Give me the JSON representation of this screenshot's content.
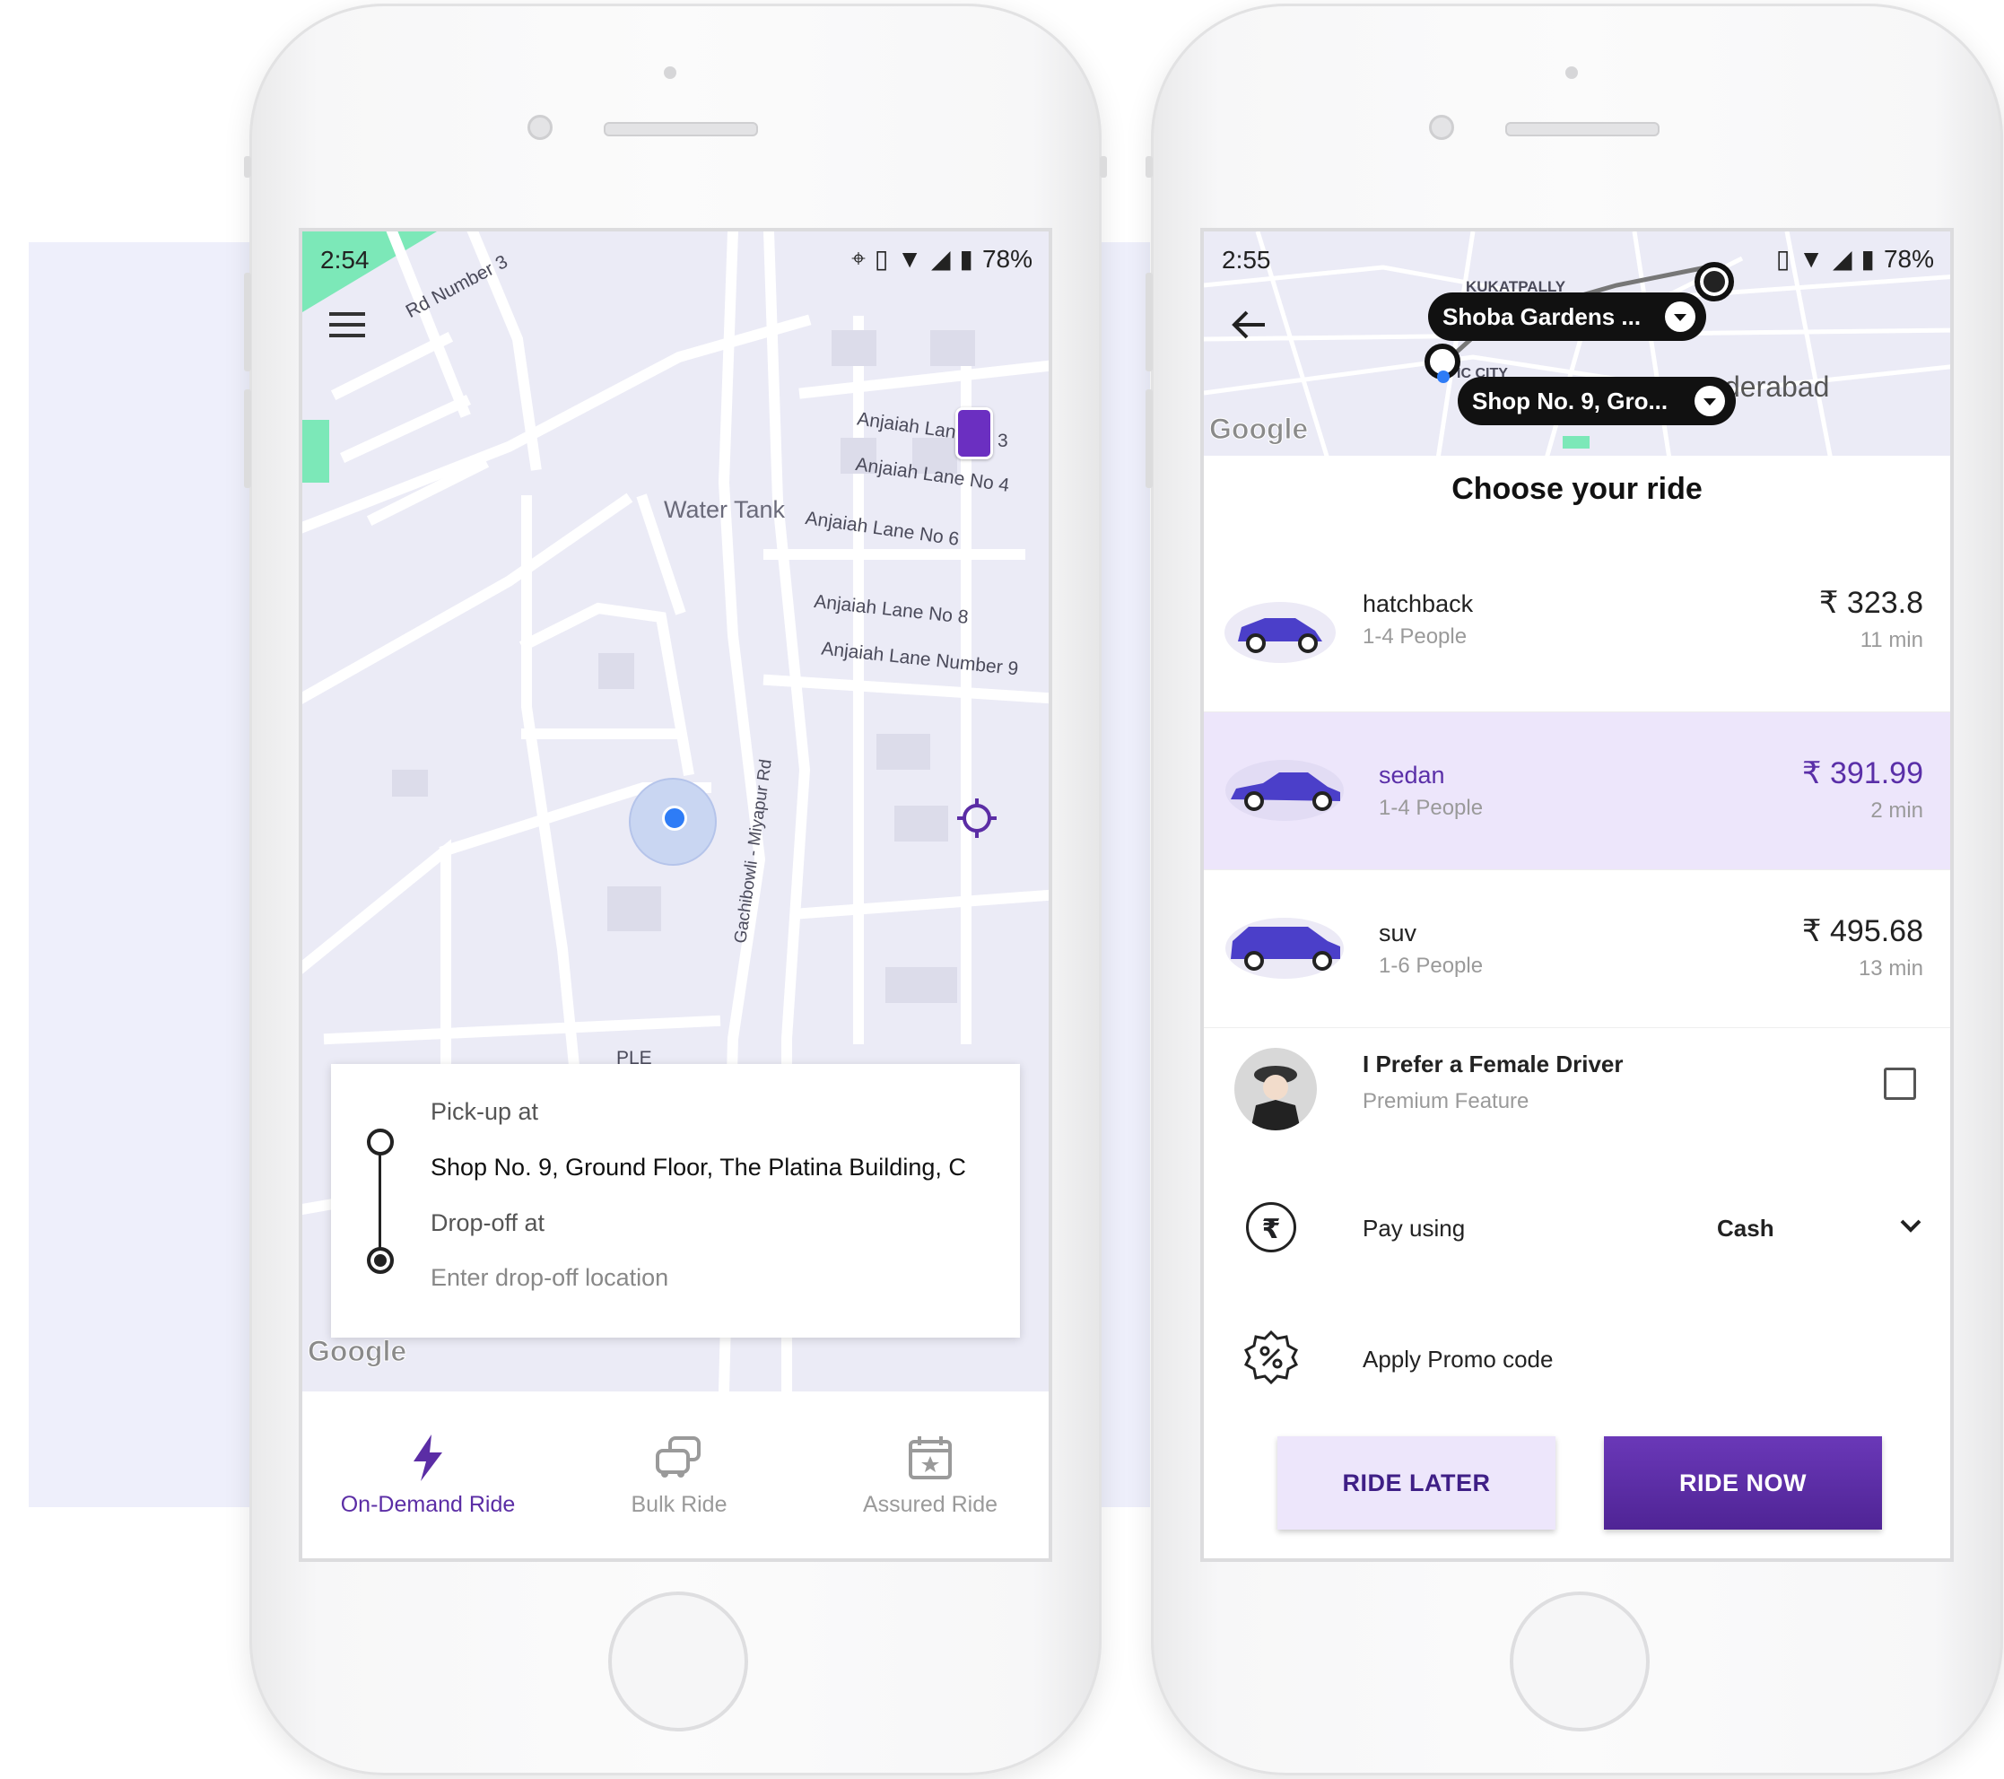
{
  "colors": {
    "accent": "#5b2da5",
    "accent_light": "#ede6fb",
    "map_bg": "#ebebf6",
    "map_green": "#7ce8b8"
  },
  "left_phone": {
    "status": {
      "time": "2:54",
      "battery": "78%"
    },
    "map": {
      "labels": {
        "rd_number": "Rd Number 3",
        "water_tank": "Water Tank",
        "lane_3a": "Anjaiah Lan",
        "lane_3b": "3",
        "lane_4": "Anjaiah Lane No 4",
        "lane_6": "Anjaiah Lane No 6",
        "lane_8": "Anjaiah Lane No 8",
        "lane_9": "Anjaiah Lane Number 9",
        "gachibowli": "Gachibowli - Miyapur Rd",
        "ple": "PLE"
      },
      "watermark": "Google"
    },
    "route_card": {
      "pickup_label": "Pick-up at",
      "pickup_value": "Shop No. 9, Ground Floor, The Platina Building, C",
      "dropoff_label": "Drop-off at",
      "dropoff_placeholder": "Enter drop-off location"
    },
    "bottom_nav": [
      {
        "label": "On-Demand Ride",
        "icon": "lightning-icon",
        "active": true
      },
      {
        "label": "Bulk Ride",
        "icon": "cars-icon",
        "active": false
      },
      {
        "label": "Assured Ride",
        "icon": "calendar-star-icon",
        "active": false
      }
    ]
  },
  "right_phone": {
    "status": {
      "time": "2:55",
      "battery": "78%"
    },
    "map": {
      "labels": {
        "kukatpally": "KUKATPALLY",
        "city": "IC CITY",
        "hyderabad": "derabad"
      },
      "pickup_pill": "Shoba Gardens ...",
      "drop_pill": "Shop No. 9, Gro...",
      "watermark": "Google"
    },
    "sheet_title": "Choose your ride",
    "rides": [
      {
        "name": "hatchback",
        "people": "1-4 People",
        "price": "₹ 323.8",
        "eta": "11 min",
        "selected": false
      },
      {
        "name": "sedan",
        "people": "1-4 People",
        "price": "₹ 391.99",
        "eta": "2 min",
        "selected": true
      },
      {
        "name": "suv",
        "people": "1-6 People",
        "price": "₹ 495.68",
        "eta": "13 min",
        "selected": false
      }
    ],
    "female_driver": {
      "title": "I Prefer a Female Driver",
      "subtitle": "Premium Feature",
      "checked": false
    },
    "payment": {
      "label": "Pay using",
      "value": "Cash"
    },
    "promo": {
      "label": "Apply Promo code"
    },
    "buttons": {
      "ride_later": "RIDE LATER",
      "ride_now": "RIDE NOW"
    }
  }
}
